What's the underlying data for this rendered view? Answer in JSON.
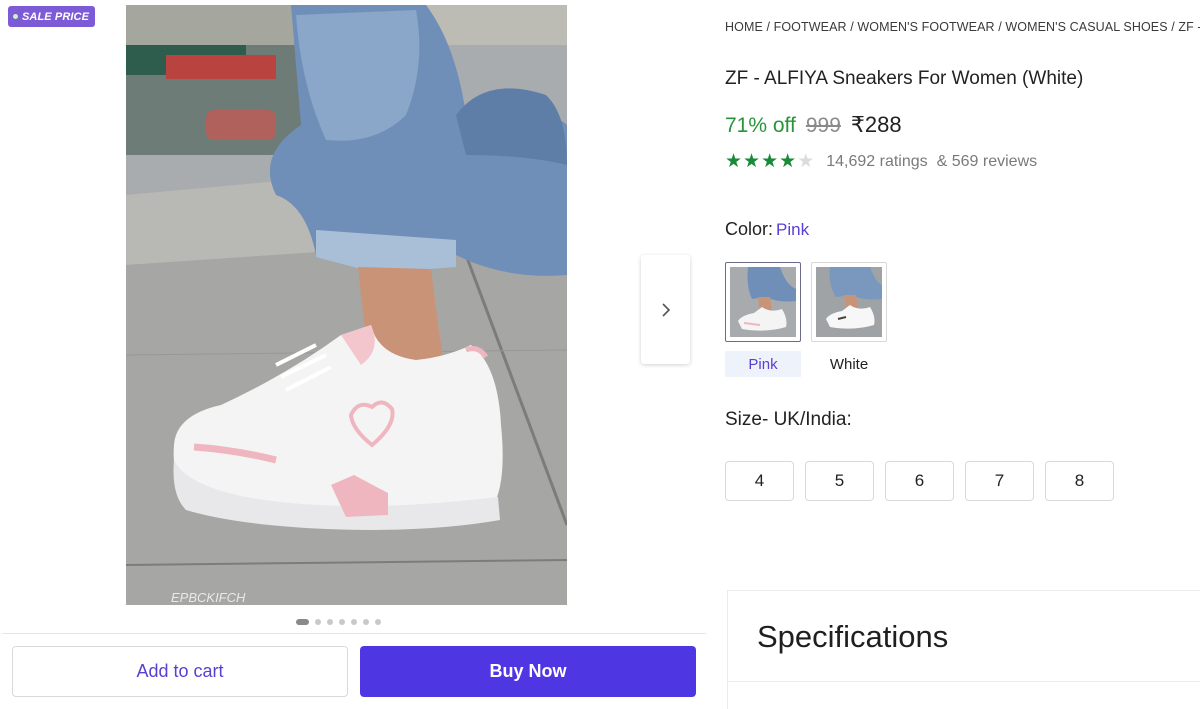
{
  "gallery": {
    "badge": "SALE PRICE",
    "image_watermark": "EPBCKIFCH",
    "dots_count": 7,
    "active_dot": 0
  },
  "breadcrumb": "HOME / FOOTWEAR / WOMEN'S FOOTWEAR / WOMEN'S CASUAL SHOES / ZF - A",
  "product": {
    "title": "ZF - ALFIYA Sneakers For Women (White)",
    "discount": "71% off",
    "mrp": "999",
    "price": "₹288",
    "rating_value": 4,
    "rating_max": 5,
    "ratings": "14,692 ratings",
    "reviews": "& 569 reviews"
  },
  "color": {
    "label": "Color:",
    "selected": "Pink",
    "options": [
      "Pink",
      "White"
    ]
  },
  "size": {
    "label": "Size- UK/India:",
    "options": [
      "4",
      "5",
      "6",
      "7",
      "8"
    ]
  },
  "actions": {
    "add_to_cart": "Add to cart",
    "buy_now": "Buy Now"
  },
  "specifications": {
    "title": "Specifications"
  },
  "colors": {
    "brand": "#4f36e3",
    "discount": "#27963a",
    "star": "#188a38",
    "badge": "#7e5bd6"
  }
}
